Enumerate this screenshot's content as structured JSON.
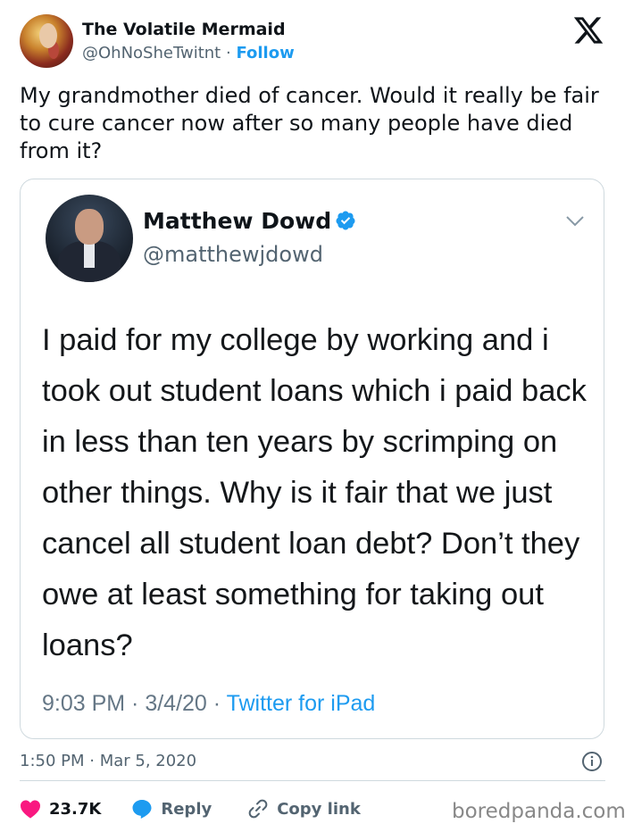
{
  "tweet": {
    "author_name": "The Volatile Mermaid",
    "author_handle": "@OhNoSheTwitnt",
    "separator": "·",
    "follow_label": "Follow",
    "text": "My grandmother died of cancer. Would it really be fair to cure cancer now after so many people have died from it?",
    "timestamp": "1:50 PM · Mar 5, 2020",
    "likes": "23.7K",
    "reply_label": "Reply",
    "copy_link_label": "Copy link"
  },
  "quoted": {
    "author_name": "Matthew Dowd",
    "author_handle": "@matthewjdowd",
    "text": "I paid for my college by working and i took out student loans which i paid back in less than ten years by scrimping on other things.  Why is it fair that we just cancel all student loan debt? Don’t they owe at least something for taking out loans?",
    "time": "9:03 PM · 3/4/20 · ",
    "source": "Twitter for iPad"
  },
  "watermark": "boredpanda.com",
  "icons": [
    "x-logo-icon",
    "verified-badge-icon",
    "chevron-down-icon",
    "info-icon",
    "heart-icon",
    "reply-bubble-icon",
    "link-icon"
  ],
  "colors": {
    "accent": "#1d9bf0",
    "like": "#f91880",
    "text": "#0f1419",
    "muted": "#536471"
  }
}
